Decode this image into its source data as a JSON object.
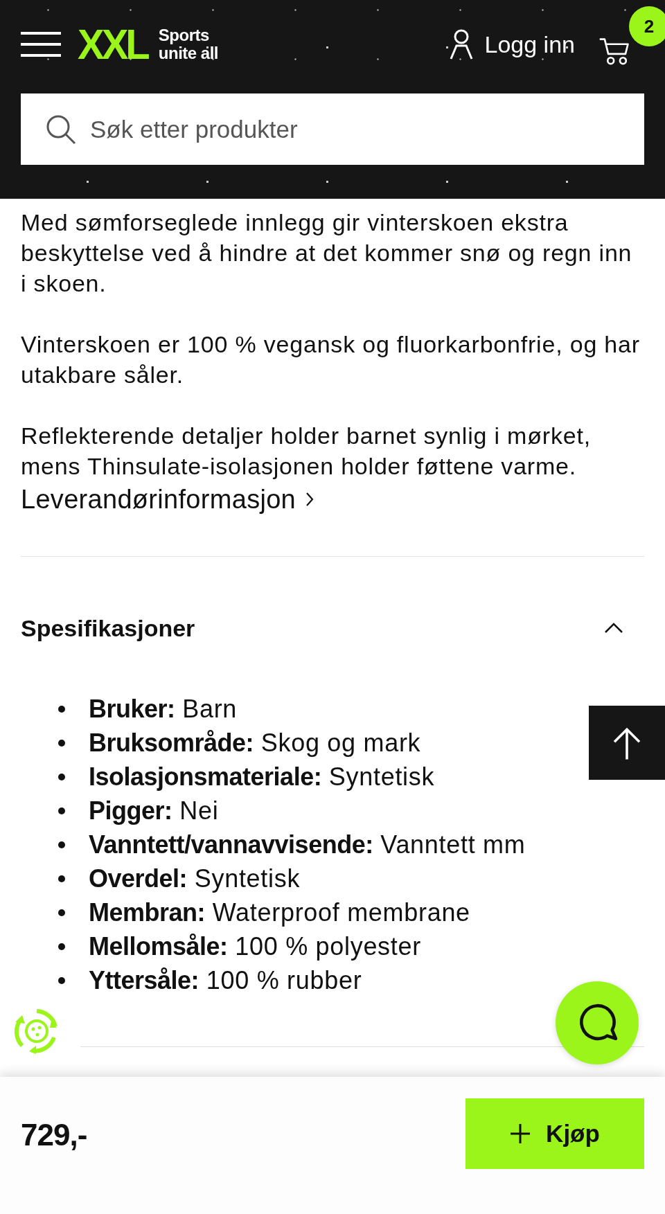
{
  "header": {
    "logo": "XXL",
    "tagline": [
      "Sports",
      "unite all"
    ],
    "login": "Logg inn",
    "cart_count": "2"
  },
  "search": {
    "placeholder": "Søk etter produkter"
  },
  "description": [
    "Med sømforseglede innlegg gir vinterskoen ekstra beskyttelse ved å hindre at det kommer snø og regn inn i skoen.",
    "Vinterskoen er 100 % vegansk og fluorkarbonfrie, og har utakbare såler.",
    "Reflekterende detaljer holder barnet synlig i mørket, mens Thinsulate-isolasjonen holder føttene varme."
  ],
  "supplier_link": "Leverandørinformasjon",
  "specifications": {
    "title": "Spesifikasjoner",
    "expanded": true,
    "items": [
      {
        "label": "Bruker:",
        "value": "Barn"
      },
      {
        "label": "Bruksområde:",
        "value": "Skog og mark"
      },
      {
        "label": "Isolasjonsmateriale:",
        "value": "Syntetisk"
      },
      {
        "label": "Pigger:",
        "value": "Nei"
      },
      {
        "label": "Vanntett/vannavvisende:",
        "value": "Vanntett mm"
      },
      {
        "label": "Overdel:",
        "value": "Syntetisk"
      },
      {
        "label": "Membran:",
        "value": "Waterproof membrane"
      },
      {
        "label": "Mellomsåle:",
        "value": "100 % polyester"
      },
      {
        "label": "Yttersåle:",
        "value": "100 % rubber"
      }
    ]
  },
  "buy_bar": {
    "price": "729,-",
    "button": "Kjøp"
  }
}
